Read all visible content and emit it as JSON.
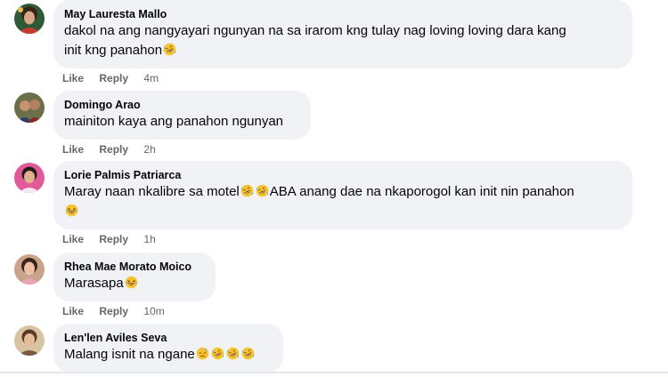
{
  "comments": [
    {
      "author": "May Lauresta Mallo",
      "text_line1": "dakol na ang nangyayari ngunyan na sa irarom kng tulay nag loving loving dara kang",
      "text_line2": "init kng panahon",
      "emojis": [
        "rofl-emoji"
      ],
      "like_label": "Like",
      "reply_label": "Reply",
      "time": "4m"
    },
    {
      "author": "Domingo Arao",
      "text": "mainiton kaya ang panahon ngunyan",
      "like_label": "Like",
      "reply_label": "Reply",
      "time": "2h"
    },
    {
      "author": "Lorie Palmis Patriarca",
      "text_part1": "Maray naan nkalibre sa motel",
      "text_part2": "ABA anang dae na nkaporogol kan init nin panahon",
      "emojis": [
        "rofl-emoji",
        "rofl-emoji",
        "laughing-emoji"
      ],
      "like_label": "Like",
      "reply_label": "Reply",
      "time": "1h"
    },
    {
      "author": "Rhea Mae Morato Moico",
      "text": "Marasapa",
      "emojis": [
        "laughing-emoji"
      ],
      "like_label": "Like",
      "reply_label": "Reply",
      "time": "10m"
    },
    {
      "author": "Len'len Aviles Seva",
      "text": "Malang isnit na ngane",
      "emojis": [
        "sad-sweat-emoji",
        "rofl-emoji",
        "rofl-emoji",
        "rofl-emoji"
      ]
    }
  ],
  "colors": {
    "bubble_bg": "#f0f2f5",
    "action_text": "#65676b",
    "emoji_face": "#f7c22f"
  }
}
